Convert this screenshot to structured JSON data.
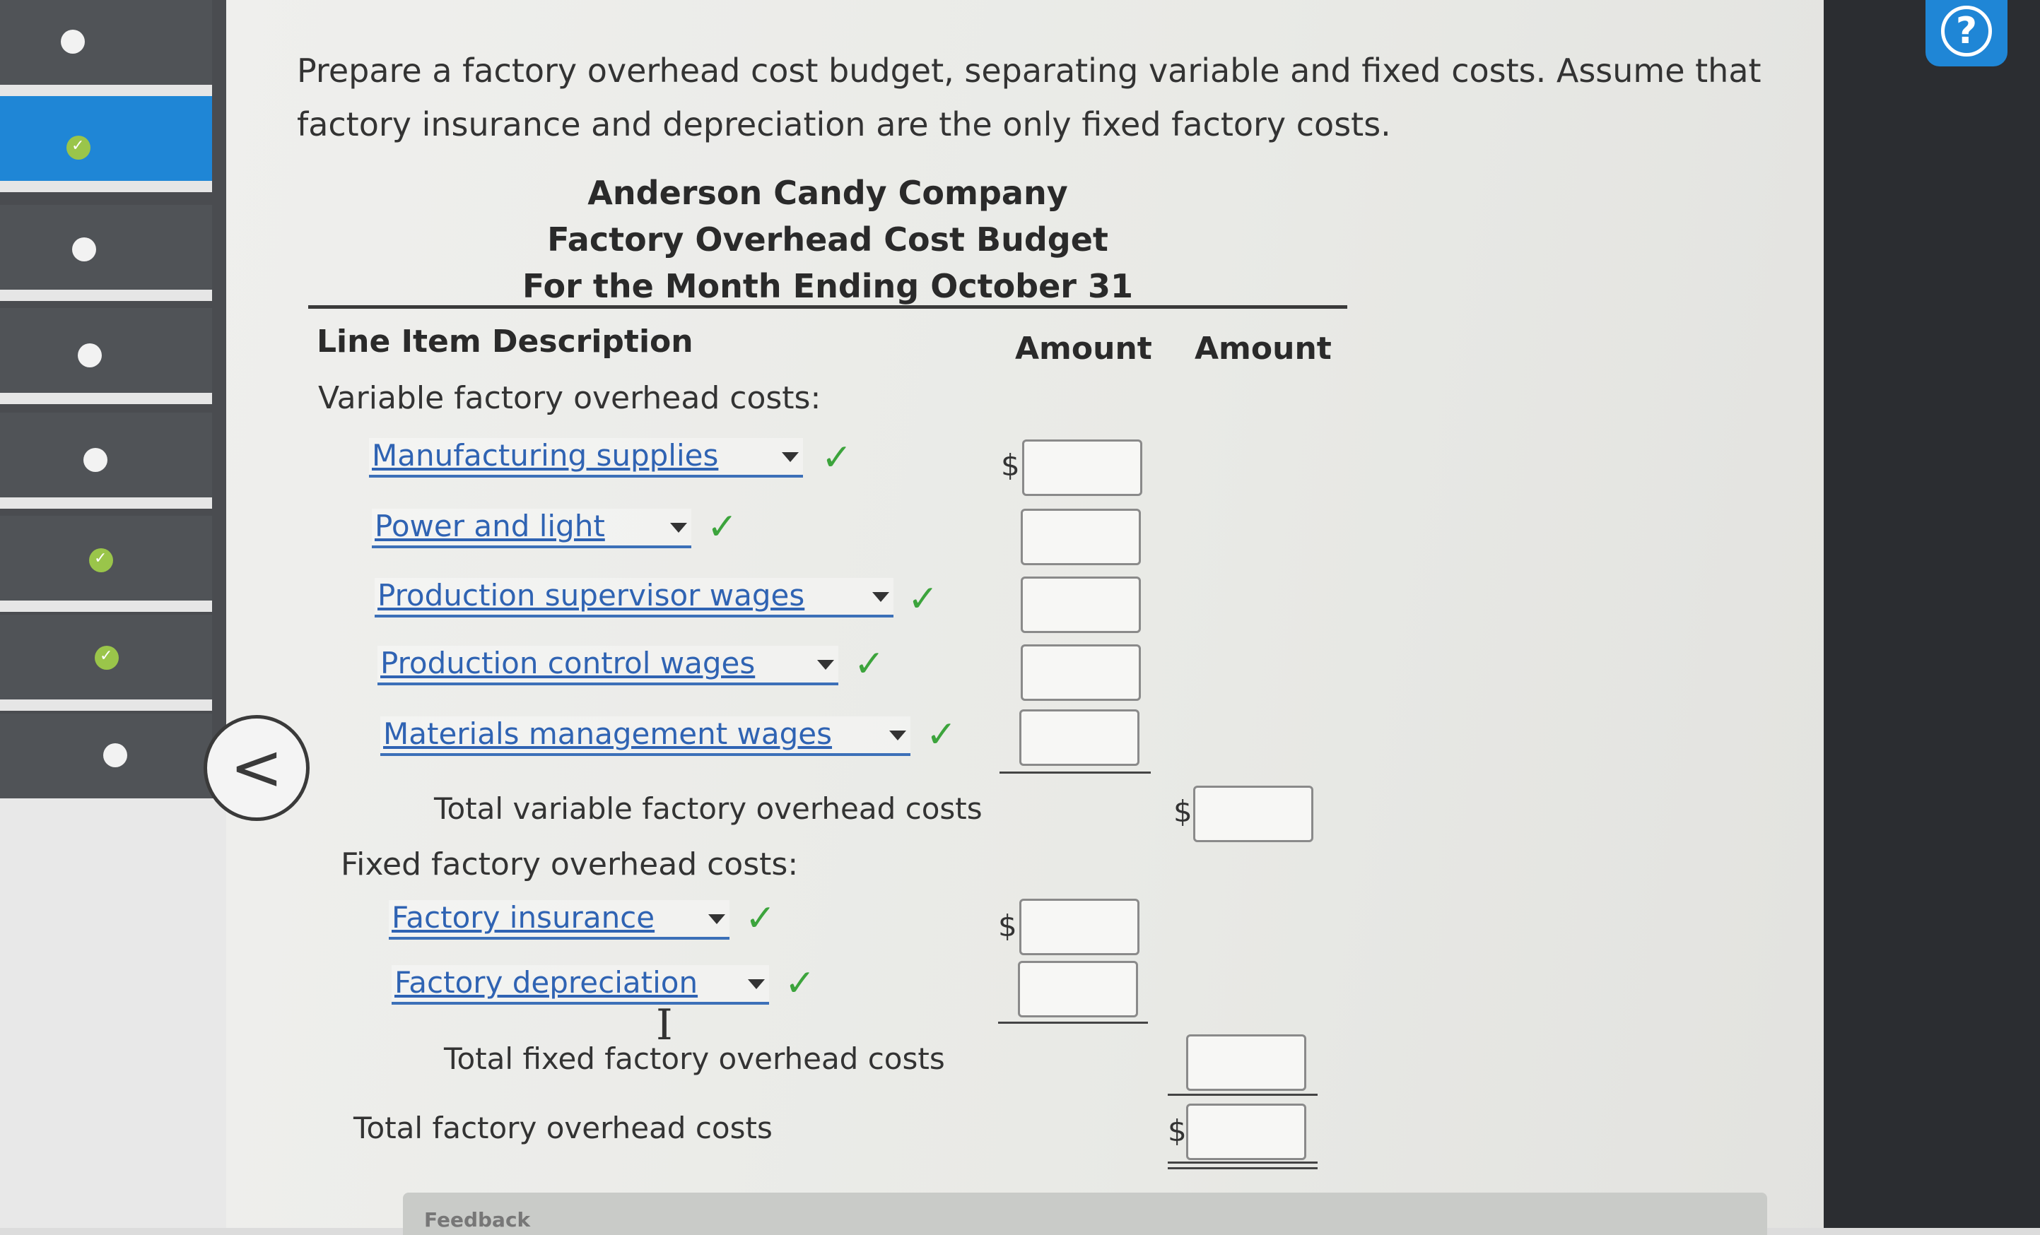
{
  "instructions": "Prepare a factory overhead cost budget, separating variable and fixed costs. Assume that factory insurance and depreciation are the only fixed factory costs.",
  "budget": {
    "company": "Anderson Candy Company",
    "title": "Factory Overhead Cost Budget",
    "period": "For the Month Ending October 31"
  },
  "columns": {
    "line_item": "Line Item Description",
    "amount_1": "Amount",
    "amount_2": "Amount"
  },
  "variable": {
    "heading": "Variable factory overhead costs:",
    "items": [
      {
        "label": "Manufacturing supplies",
        "value": ""
      },
      {
        "label": "Power and light",
        "value": ""
      },
      {
        "label": "Production supervisor wages",
        "value": ""
      },
      {
        "label": "Production control wages",
        "value": ""
      },
      {
        "label": "Materials management wages",
        "value": ""
      }
    ],
    "total_label": "Total variable factory overhead costs",
    "total_value": ""
  },
  "fixed": {
    "heading": "Fixed factory overhead costs:",
    "items": [
      {
        "label": "Factory insurance",
        "value": ""
      },
      {
        "label": "Factory depreciation",
        "value": ""
      }
    ],
    "total_label": "Total fixed factory overhead costs",
    "total_value": ""
  },
  "grand_total": {
    "label": "Total factory overhead costs",
    "value": ""
  },
  "currency_symbol": "$",
  "check_mark": "✓",
  "feedback_label": "Feedback",
  "help_label": "?",
  "back_label": "<",
  "colors": {
    "accent_blue": "#1f86d6",
    "link_blue": "#2f63b3",
    "check_green": "#3ca43c"
  }
}
